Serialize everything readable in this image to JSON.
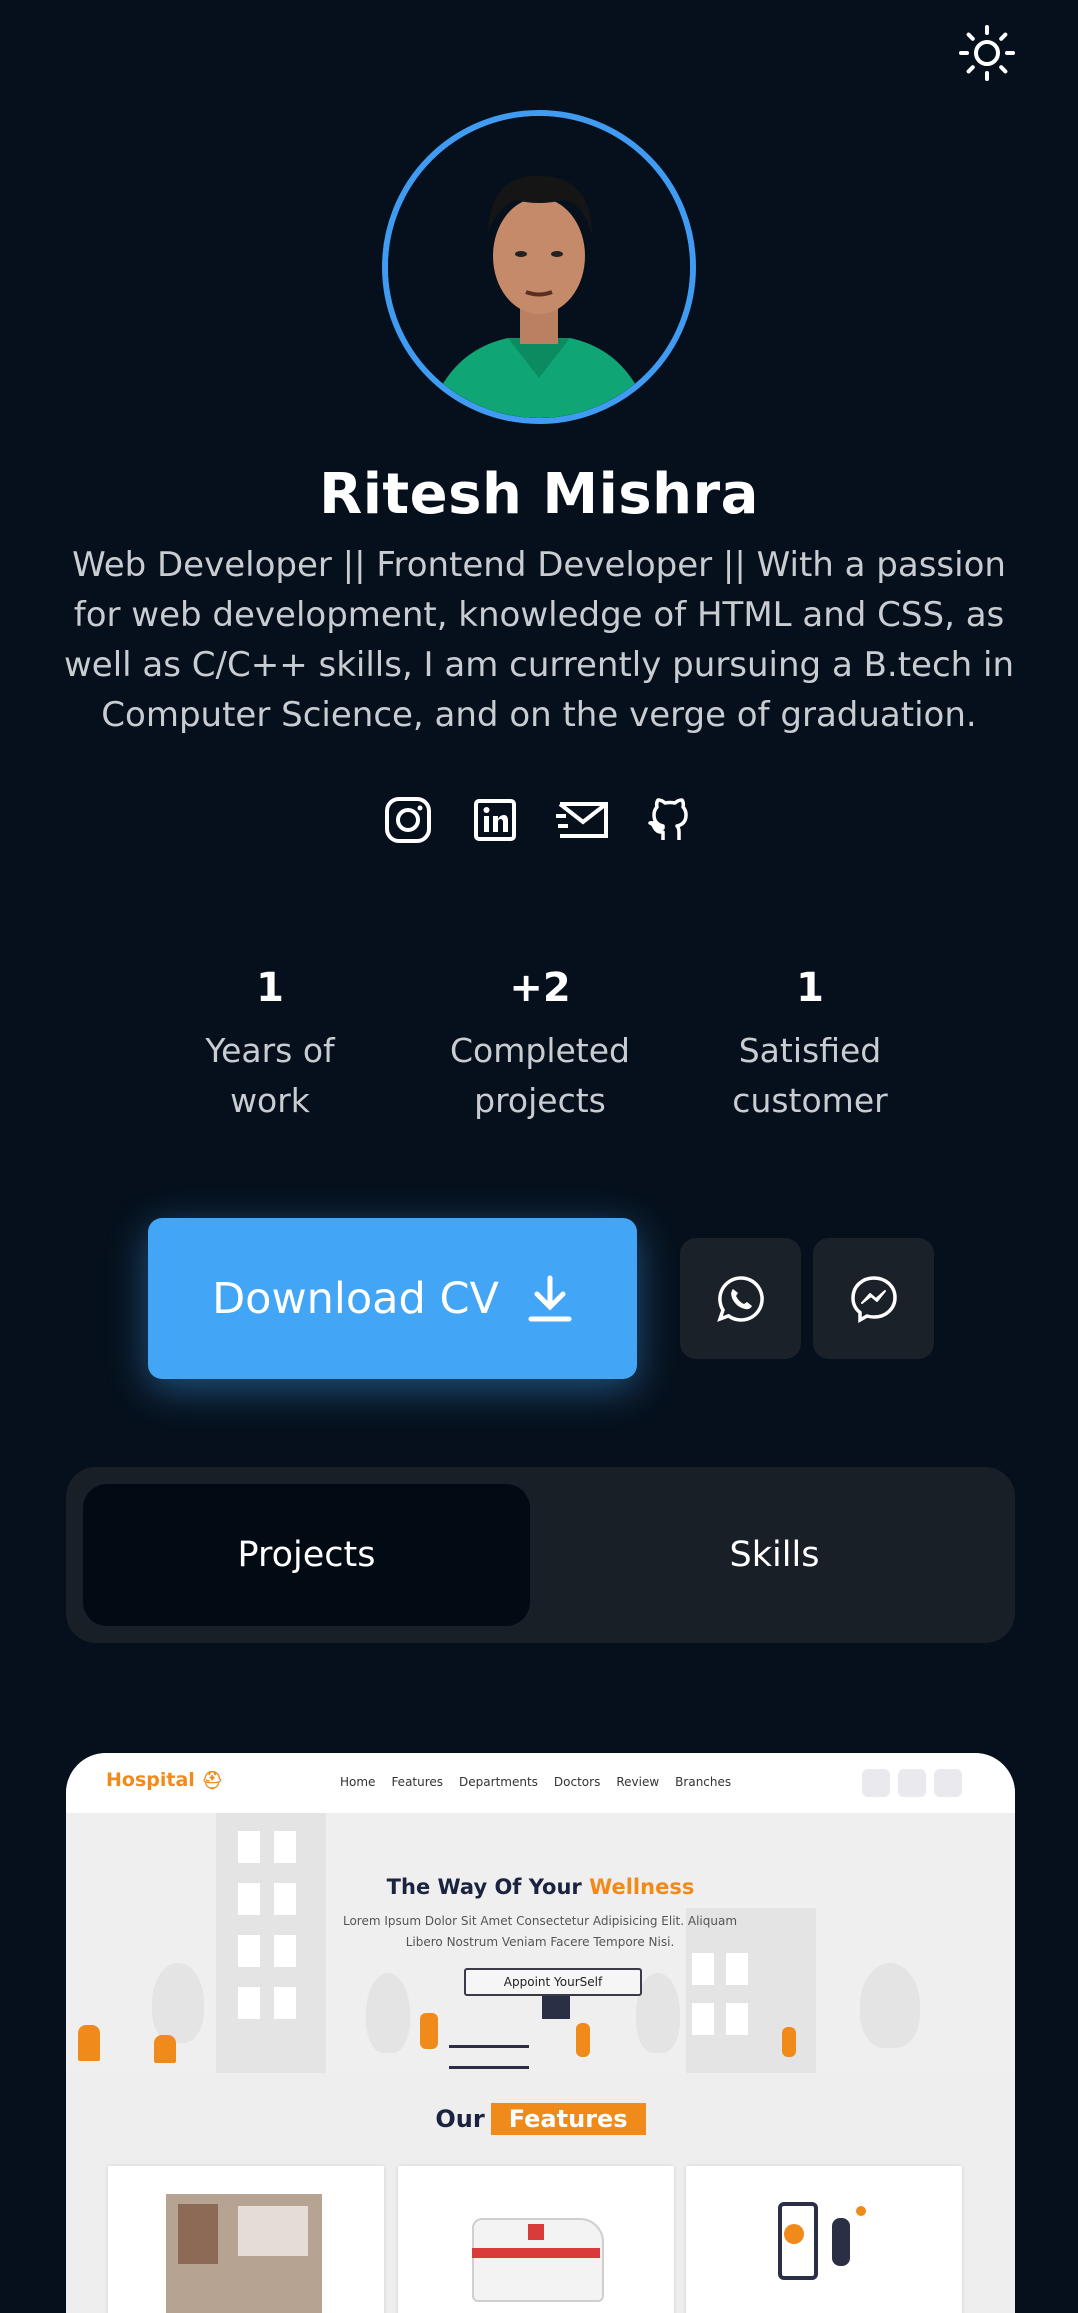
{
  "header": {
    "theme_toggle_icon": "sun-icon"
  },
  "profile": {
    "name": "Ritesh Mishra",
    "bio": "Web Developer || Frontend Developer || With a passion for web development, knowledge of HTML and CSS, as well as C/C++ skills, I am currently pursuing a B.tech in Computer Science, and on the verge of graduation.",
    "ring_color": "#3f9cf2"
  },
  "socials": [
    "instagram-icon",
    "linkedin-icon",
    "mail-icon",
    "github-icon"
  ],
  "stats": [
    {
      "value": "1",
      "label_line1": "Years of",
      "label_line2": "work"
    },
    {
      "value": "+2",
      "label_line1": "Completed",
      "label_line2": "projects"
    },
    {
      "value": "1",
      "label_line1": "Satisfied",
      "label_line2": "customer"
    }
  ],
  "actions": {
    "download_cv": "Download CV",
    "download_icon": "download-icon",
    "whatsapp_icon": "whatsapp-icon",
    "messenger_icon": "messenger-icon",
    "accent": "#43a5f5"
  },
  "tabs": [
    {
      "label": "Projects",
      "active": true
    },
    {
      "label": "Skills",
      "active": false
    }
  ],
  "project_preview": {
    "logo": "Hospital",
    "menu": [
      "Home",
      "Features",
      "Departments",
      "Doctors",
      "Review",
      "Branches"
    ],
    "hero_title_start": "The Way Of Your ",
    "hero_title_accent": "Wellness",
    "hero_sub_line1": "Lorem Ipsum Dolor Sit Amet Consectetur Adipisicing Elit. Aliquam",
    "hero_sub_line2": "Libero Nostrum Veniam Facere Tempore Nisi.",
    "hero_button": "Appoint YourSelf",
    "features_prefix": "Our",
    "features_badge": "Features",
    "brand_color": "#f08a1a"
  }
}
